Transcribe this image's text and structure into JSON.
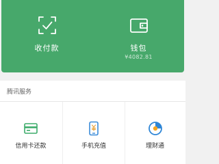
{
  "top_panel": {
    "collect": {
      "label": "收付款",
      "icon": "qr-scan-icon"
    },
    "wallet": {
      "label": "钱包",
      "balance": "¥4082.81",
      "icon": "wallet-icon"
    }
  },
  "tencent_services": {
    "title": "腾讯服务",
    "items": [
      {
        "label": "信用卡还款",
        "icon": "credit-card-icon",
        "color": "#3cab6a"
      },
      {
        "label": "手机充值",
        "icon": "phone-icon",
        "color": "#3a8bd8"
      },
      {
        "label": "理财通",
        "icon": "wealth-icon",
        "color": "#2f86d6"
      }
    ]
  },
  "colors": {
    "panel_green": "#47a86b",
    "page_bg": "#f1f1f1"
  }
}
